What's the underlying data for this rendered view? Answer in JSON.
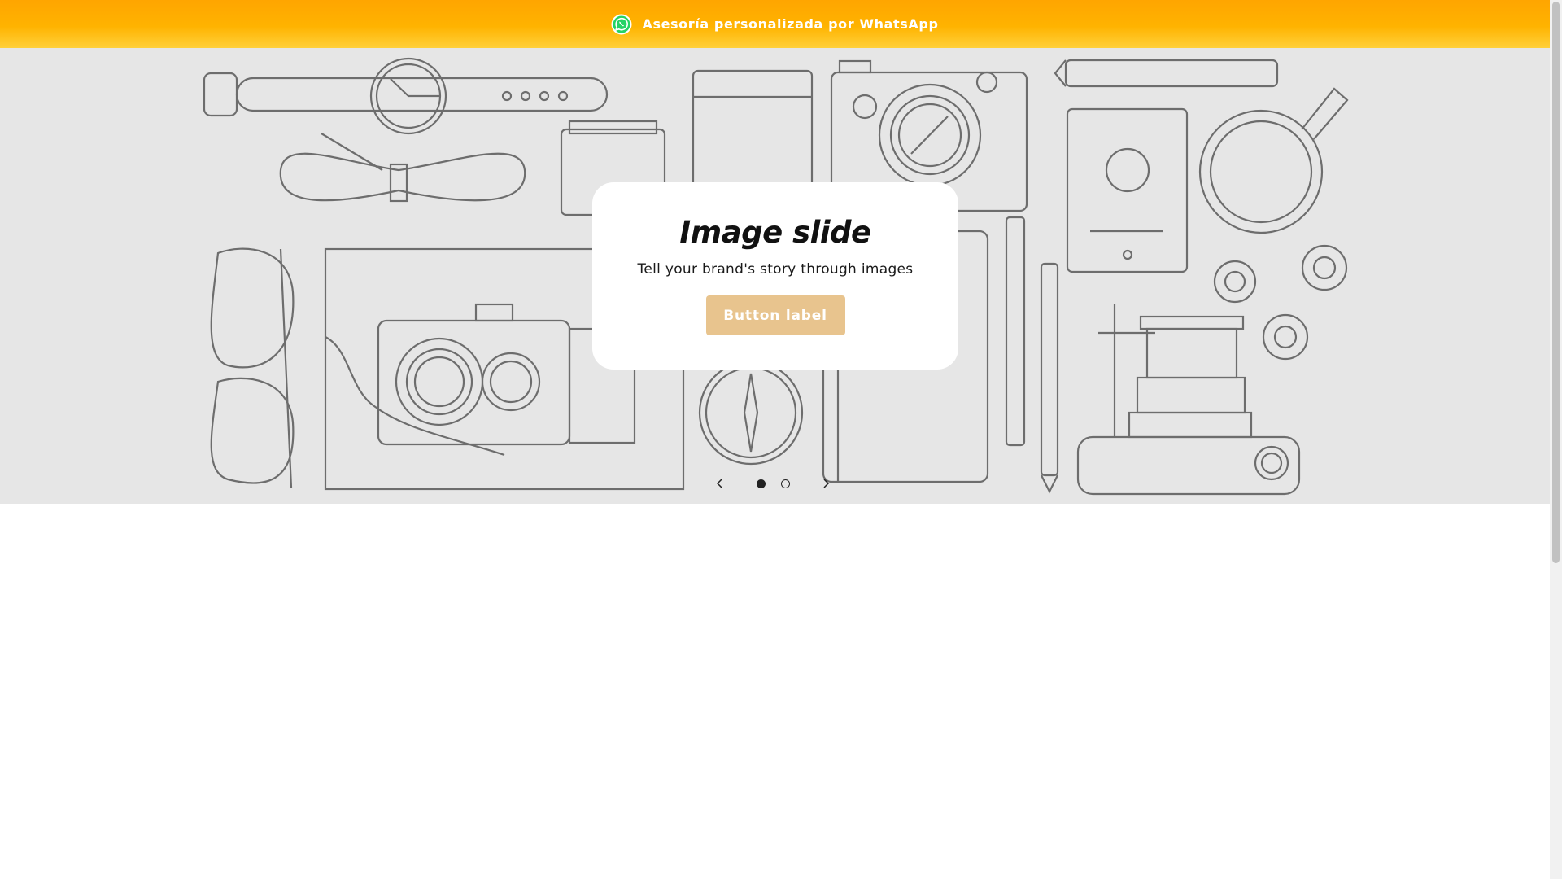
{
  "announcement": {
    "text": "Asesoría personalizada por WhatsApp",
    "icon": "whatsapp-icon",
    "gradient_top": "#ffa500",
    "gradient_bottom": "#ffd03a"
  },
  "slideshow": {
    "background": "#e6e6e6",
    "heading": "Image slide",
    "subheading": "Tell your brand's story through images",
    "button_label": "Button label",
    "button_color": "#e8c48e",
    "prev_icon": "chevron-left-icon",
    "next_icon": "chevron-right-icon",
    "slide_count": 2,
    "active_slide": 1
  }
}
